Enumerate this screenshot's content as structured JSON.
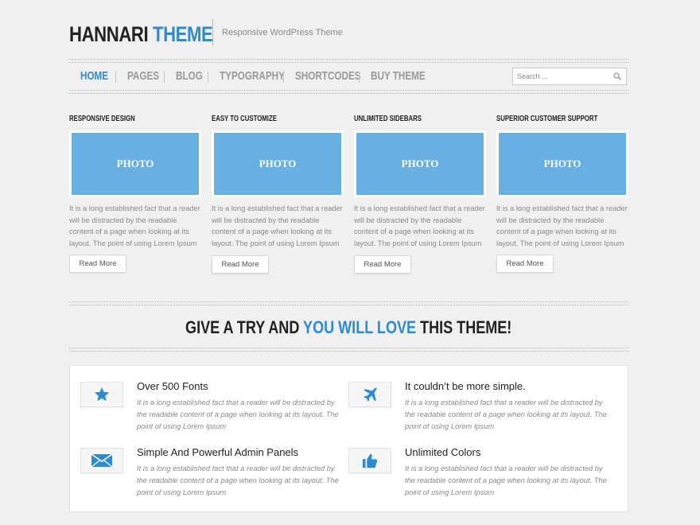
{
  "header": {
    "logo_part1": "HANNARI",
    "logo_part2": "THEME",
    "tagline": "Responsive WordPress Theme"
  },
  "nav": {
    "items": [
      {
        "label": "HOME",
        "active": true
      },
      {
        "label": "PAGES",
        "active": false
      },
      {
        "label": "BLOG",
        "active": false
      },
      {
        "label": "TYPOGRAPHY",
        "active": false
      },
      {
        "label": "SHORTCODES",
        "active": false
      },
      {
        "label": "BUY THEME",
        "active": false
      }
    ]
  },
  "search": {
    "placeholder": "Search ..."
  },
  "features": [
    {
      "title": "RESPONSIVE DESIGN",
      "photo": "PHOTO",
      "text": "It is a long established fact that a reader will be distracted by the readable content of a page when looking at its layout. The point of using Lorem Ipsum",
      "button": "Read More"
    },
    {
      "title": "EASY TO CUSTOMIZE",
      "photo": "PHOTO",
      "text": "It is a long established fact that a reader will be distracted by the readable content of a page when looking at its layout. The point of using Lorem Ipsum",
      "button": "Read More"
    },
    {
      "title": "UNLIMITED SIDEBARS",
      "photo": "PHOTO",
      "text": "It is a long established fact that a reader will be distracted by the readable content of a page when looking at its layout. The point of using Lorem Ipsum",
      "button": "Read More"
    },
    {
      "title": "SUPERIOR CUSTOMER SUPPORT",
      "photo": "PHOTO",
      "text": "It is a long established fact that a reader will be distracted by the readable content of a page when looking at its layout. The point of using Lorem Ipsum",
      "button": "Read More"
    }
  ],
  "cta": {
    "part1": "GIVE A TRY AND",
    "part2": "YOU WILL LOVE",
    "part3": "THIS THEME!"
  },
  "services": [
    {
      "icon": "star-icon",
      "title": "Over 500 Fonts",
      "text": "It is a long established fact that a reader will be distracted by the readable content of a page when looking at its layout. The point of using Lorem Ipsum"
    },
    {
      "icon": "airplane-icon",
      "title": "It couldn’t be more simple.",
      "text": "It is a long established fact that a reader will be distracted by the readable content of a page when looking at its layout. The point of using Lorem Ipsum"
    },
    {
      "icon": "envelope-icon",
      "title": "Simple And Powerful Admin Panels",
      "text": "It is a long established fact that a reader will be distracted by the readable content of a page when looking at its layout. The point of using Lorem Ipsum"
    },
    {
      "icon": "thumbs-up-icon",
      "title": "Unlimited Colors",
      "text": "It is a long established fact that a reader will be distracted by the readable content of a page when looking at its layout. The point of using Lorem Ipsum"
    }
  ],
  "colors": {
    "accent": "#2e8bd0",
    "photo_placeholder": "#69b0e2",
    "background": "#f0f0f0"
  }
}
